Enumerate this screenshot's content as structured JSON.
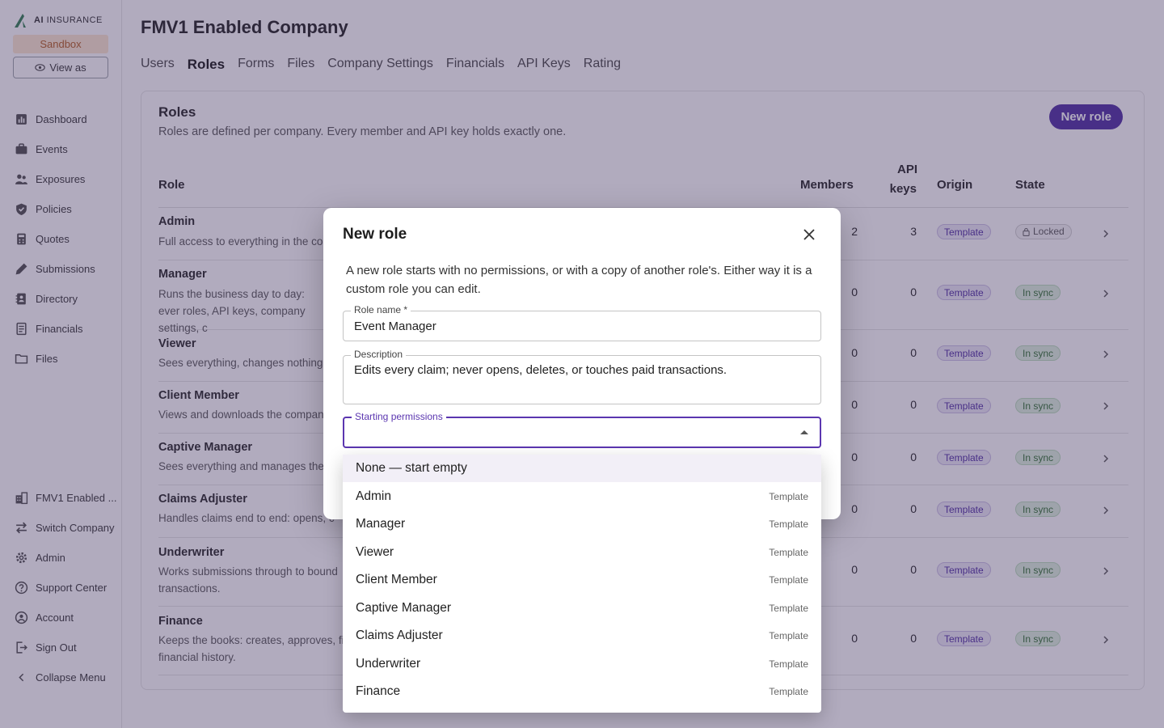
{
  "brand": {
    "name_bold": "AI",
    "name_rest": "INSURANCE"
  },
  "sandbox_label": "Sandbox",
  "view_as_label": "View as",
  "nav_main": [
    "Dashboard",
    "Events",
    "Exposures",
    "Policies",
    "Quotes",
    "Submissions",
    "Directory",
    "Financials",
    "Files"
  ],
  "nav_bottom": [
    "FMV1 Enabled ...",
    "Switch Company",
    "Admin",
    "Support Center",
    "Account",
    "Sign Out",
    "Collapse Menu"
  ],
  "company_title": "FMV1 Enabled Company",
  "tabs": [
    "Users",
    "Roles",
    "Forms",
    "Files",
    "Company Settings",
    "Financials",
    "API Keys",
    "Rating"
  ],
  "active_tab": "Roles",
  "roles_card": {
    "title": "Roles",
    "subtitle": "Roles are defined per company. Every member and API key holds exactly one.",
    "new_role_label": "New role",
    "columns": {
      "role": "Role",
      "members": "Members",
      "api_keys_1": "API",
      "api_keys_2": "keys",
      "origin": "Origin",
      "state": "State"
    },
    "rows": [
      {
        "name": "Admin",
        "desc": "Full access to everything in the com",
        "members": "2",
        "api_keys": "3",
        "origin": "Template",
        "state": "Locked"
      },
      {
        "name": "Manager",
        "desc": "Runs the business day to day: ever roles, API keys, company settings, c",
        "members": "0",
        "api_keys": "0",
        "origin": "Template",
        "state": "In sync"
      },
      {
        "name": "Viewer",
        "desc": "Sees everything, changes nothing.",
        "members": "0",
        "api_keys": "0",
        "origin": "Template",
        "state": "In sync"
      },
      {
        "name": "Client Member",
        "desc": "Views and downloads the company",
        "members": "0",
        "api_keys": "0",
        "origin": "Template",
        "state": "In sync"
      },
      {
        "name": "Captive Manager",
        "desc": "Sees everything and manages the c",
        "members": "0",
        "api_keys": "0",
        "origin": "Template",
        "state": "In sync"
      },
      {
        "name": "Claims Adjuster",
        "desc": "Handles claims end to end: opens, c",
        "members": "0",
        "api_keys": "0",
        "origin": "Template",
        "state": "In sync"
      },
      {
        "name": "Underwriter",
        "desc": "Works submissions through to bound transactions.",
        "members": "0",
        "api_keys": "0",
        "origin": "Template",
        "state": "In sync"
      },
      {
        "name": "Finance",
        "desc": "Keeps the books: creates, approves, fi financial history.",
        "members": "0",
        "api_keys": "0",
        "origin": "Template",
        "state": "In sync"
      }
    ]
  },
  "modal": {
    "title": "New role",
    "intro": "A new role starts with no permissions, or with a copy of another role's. Either way it is a custom role you can edit.",
    "role_name_label": "Role name *",
    "role_name_value": "Event Manager",
    "description_label": "Description",
    "description_value": "Edits every claim; never opens, deletes, or touches paid transactions.",
    "starting_permissions_label": "Starting permissions",
    "starting_permissions_value": ""
  },
  "dropdown": {
    "options": [
      {
        "label": "None — start empty",
        "tag": ""
      },
      {
        "label": "Admin",
        "tag": "Template"
      },
      {
        "label": "Manager",
        "tag": "Template"
      },
      {
        "label": "Viewer",
        "tag": "Template"
      },
      {
        "label": "Client Member",
        "tag": "Template"
      },
      {
        "label": "Captive Manager",
        "tag": "Template"
      },
      {
        "label": "Claims Adjuster",
        "tag": "Template"
      },
      {
        "label": "Underwriter",
        "tag": "Template"
      },
      {
        "label": "Finance",
        "tag": "Template"
      }
    ]
  },
  "colors": {
    "accent": "#4b2aa0",
    "sandbox_bg": "#fde7cf",
    "sync_bg": "#dff1df",
    "template_bg": "#ede8f6"
  }
}
